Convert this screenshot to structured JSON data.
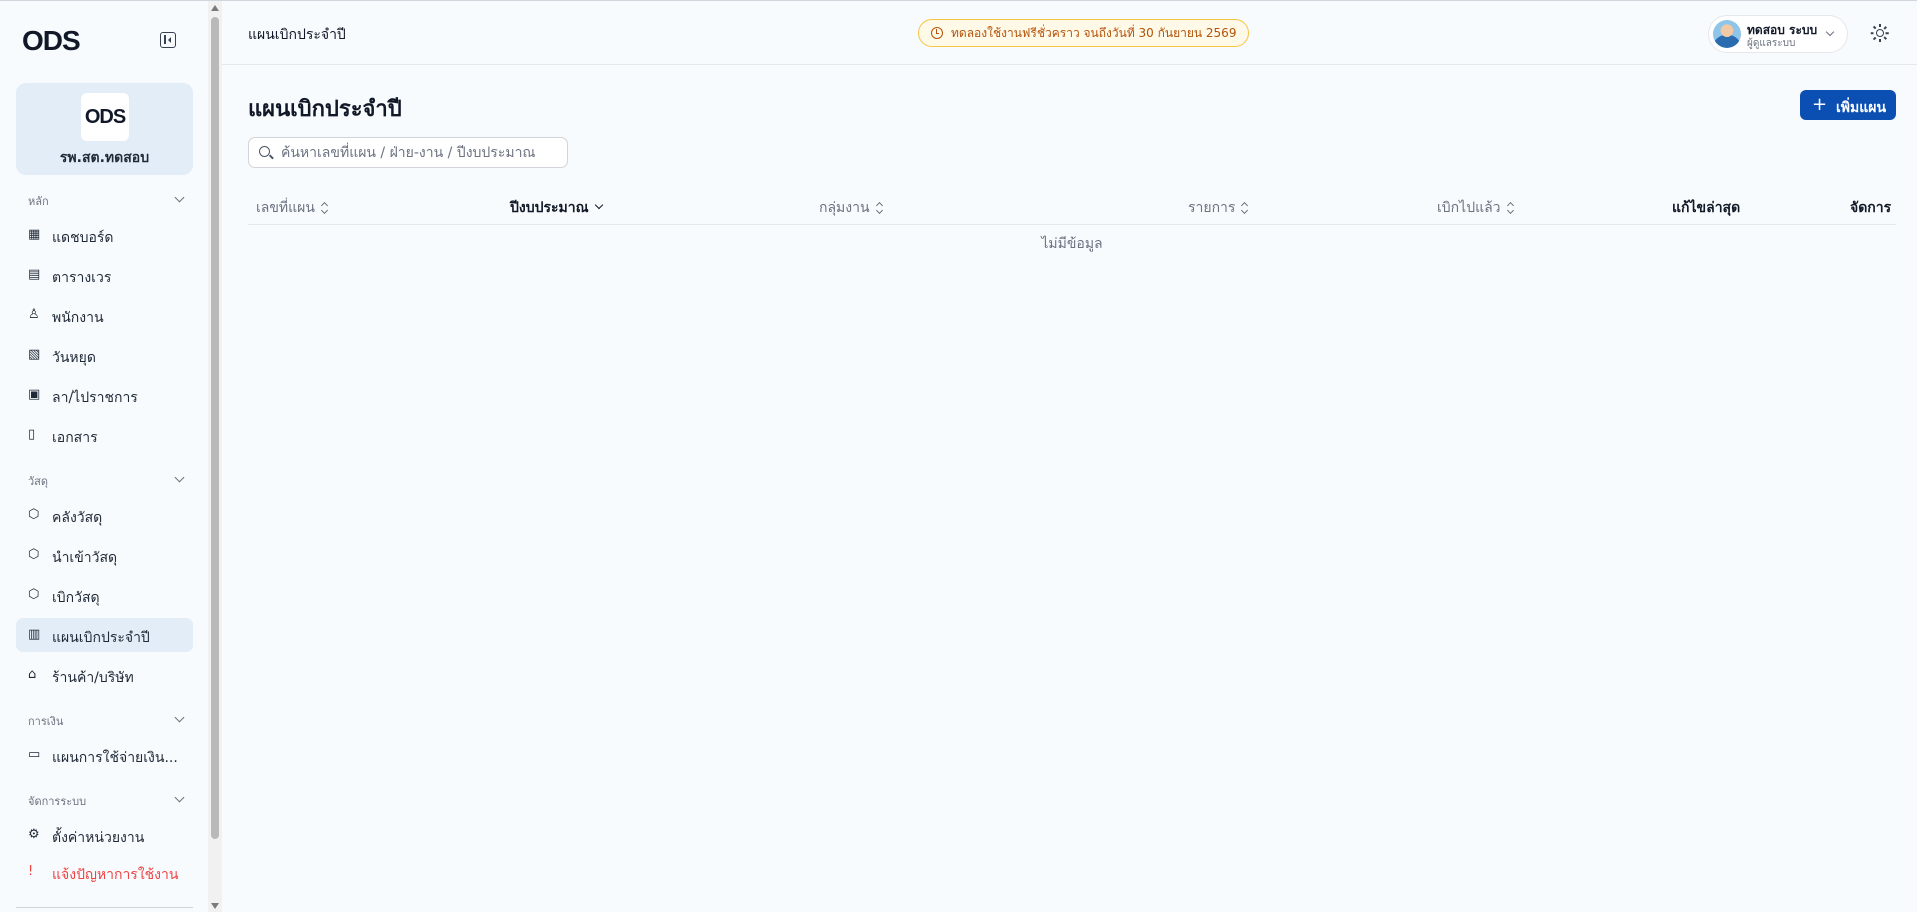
{
  "brand": {
    "logo_text": "ODS"
  },
  "org": {
    "logo_text": "ODS",
    "name": "รพ.สต.ทดสอบ"
  },
  "sidebar": {
    "sections": [
      {
        "label": "หลัก"
      },
      {
        "label": "วัสดุ"
      },
      {
        "label": "การเงิน"
      },
      {
        "label": "จัดการระบบ"
      }
    ],
    "items": [
      {
        "label": "แดชบอร์ด",
        "icon": "dashboard-icon"
      },
      {
        "label": "ตารางเวร",
        "icon": "calendar-icon"
      },
      {
        "label": "พนักงาน",
        "icon": "users-icon"
      },
      {
        "label": "วันหยุด",
        "icon": "calendar-off-icon"
      },
      {
        "label": "ลา/ไปราชการ",
        "icon": "calendar-x-icon"
      },
      {
        "label": "เอกสาร",
        "icon": "file-icon"
      },
      {
        "label": "คลังวัสดุ",
        "icon": "package-icon"
      },
      {
        "label": "นำเข้าวัสดุ",
        "icon": "package-plus-icon"
      },
      {
        "label": "เบิกวัสดุ",
        "icon": "package-out-icon"
      },
      {
        "label": "แผนเบิกประจำปี",
        "icon": "clipboard-icon"
      },
      {
        "label": "ร้านค้า/บริษัท",
        "icon": "store-icon"
      },
      {
        "label": "แผนการใช้จ่ายเงิน...",
        "icon": "wallet-icon"
      },
      {
        "label": "ตั้งค่าหน่วยงาน",
        "icon": "gear-icon"
      },
      {
        "label": "แจ้งปัญหาการใช้งาน",
        "icon": "alert-message-icon"
      }
    ]
  },
  "topbar": {
    "breadcrumb": "แผนเบิกประจำปี",
    "trial_notice": "ทดลองใช้งานฟรีชั่วคราว จนถึงวันที่ 30 กันยายน 2569",
    "user": {
      "name": "ทดสอบ ระบบ",
      "role": "ผู้ดูแลระบบ"
    }
  },
  "main": {
    "title": "แผนเบิกประจำปี",
    "add_button": "เพิ่มแผน",
    "search_placeholder": "ค้นหาเลขที่แผน / ฝ่าย-งาน / ปีงบประมาณ",
    "search_value": "",
    "columns": [
      "เลขที่แผน",
      "ปีงบประมาณ",
      "กลุ่มงาน",
      "รายการ",
      "เบิกไปแล้ว",
      "แก้ไขล่าสุด",
      "จัดการ"
    ],
    "rows": [],
    "empty_text": "ไม่มีข้อมูล"
  },
  "colors": {
    "primary": "#0b4fb3",
    "active_bg": "#e2edf8",
    "warning": "#b45309",
    "danger": "#ef4444"
  }
}
